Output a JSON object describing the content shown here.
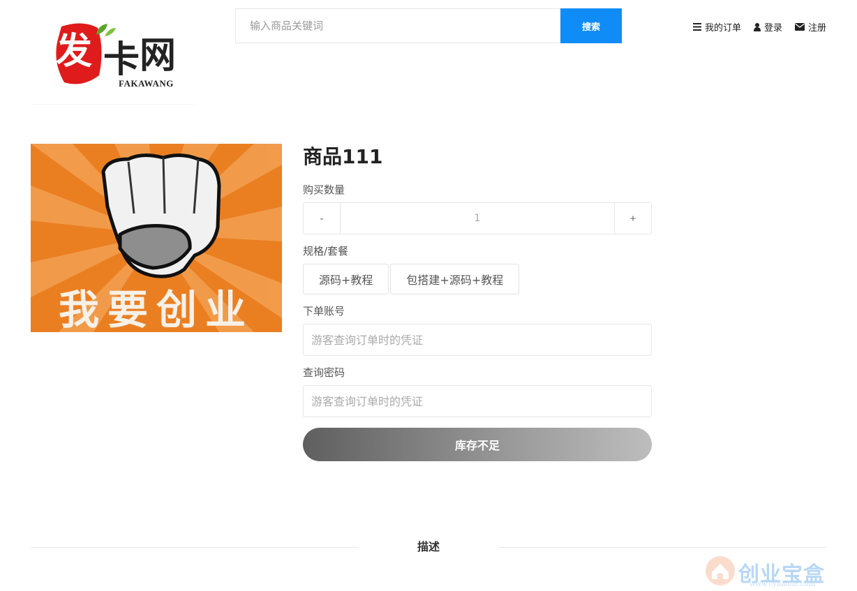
{
  "header": {
    "logo": {
      "chars": [
        "发",
        "卡",
        "网"
      ],
      "subtitle": "FAKAWANG"
    },
    "search": {
      "placeholder": "输入商品关键词",
      "button_label": "搜索"
    },
    "nav": [
      {
        "label": "我的订单",
        "icon": "list-icon"
      },
      {
        "label": "登录",
        "icon": "user-icon"
      },
      {
        "label": "注册",
        "icon": "envelope-icon"
      }
    ]
  },
  "product": {
    "image_text": "我要创业",
    "title": "商品111",
    "quantity_label": "购买数量",
    "quantity": {
      "minus": "-",
      "value": "1",
      "plus": "+"
    },
    "spec_label": "规格/套餐",
    "specs": [
      "源码+教程",
      "包搭建+源码+教程"
    ],
    "account_label": "下单账号",
    "account_placeholder": "游客查询订单时的凭证",
    "password_label": "查询密码",
    "password_placeholder": "游客查询订单时的凭证",
    "buy_button": "库存不足"
  },
  "description": {
    "title": "描述"
  },
  "watermark": {
    "text": "创业宝盒",
    "url": "www.cybaohe.com"
  },
  "colors": {
    "search_button": "#0f8cf6",
    "image_orange": "#e8822a",
    "buy_button_start": "#5f5f5f",
    "buy_button_end": "#bdbdbd"
  }
}
